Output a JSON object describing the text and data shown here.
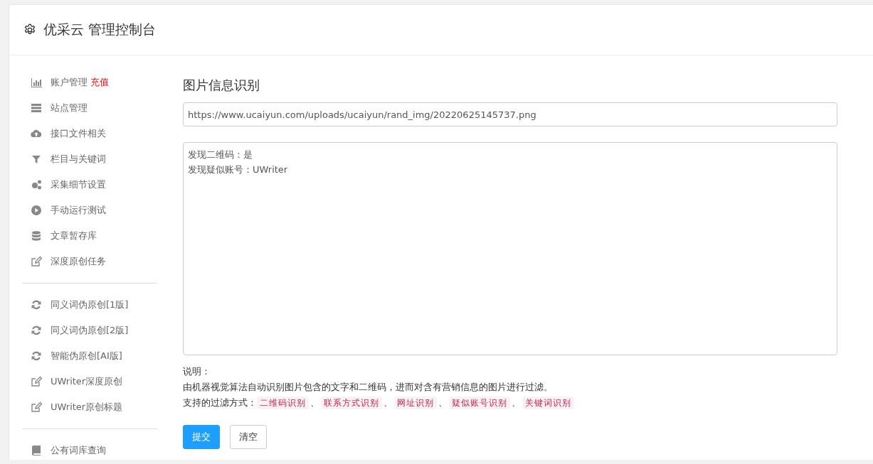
{
  "header": {
    "title": "优采云 管理控制台"
  },
  "sidebar": {
    "groups": [
      {
        "items": [
          {
            "label": "账户管理",
            "badge": "充值"
          },
          {
            "label": "站点管理"
          },
          {
            "label": "接口文件相关"
          },
          {
            "label": "栏目与关键词"
          },
          {
            "label": "采集细节设置"
          },
          {
            "label": "手动运行测试"
          },
          {
            "label": "文章暂存库"
          },
          {
            "label": "深度原创任务"
          }
        ]
      },
      {
        "items": [
          {
            "label": "同义词伪原创[1版]"
          },
          {
            "label": "同义词伪原创[2版]"
          },
          {
            "label": "智能伪原创[AI版]"
          },
          {
            "label": "UWriter深度原创"
          },
          {
            "label": "UWriter原创标题"
          }
        ]
      },
      {
        "items": [
          {
            "label": "公有词库查询"
          }
        ]
      }
    ]
  },
  "main": {
    "title": "图片信息识别",
    "url_field": {
      "value": "https://www.ucaiyun.com/uploads/ucaiyun/rand_img/20220625145737.png"
    },
    "result_box": {
      "lines": [
        "发现二维码：是",
        "发现疑似账号：UWriter"
      ]
    },
    "notes": {
      "label": "说明：",
      "description": "由机器视觉算法自动识别图片包含的文字和二维码，进而对含有营销信息的图片进行过滤。",
      "filters_label": "支持的过滤方式：",
      "filters": [
        "二维码识别",
        "联系方式识别",
        "网址识别",
        "疑似账号识别",
        "关键词识别"
      ],
      "separator": "、"
    },
    "buttons": [
      {
        "kind": "primary",
        "label": "提交"
      },
      {
        "kind": "default",
        "label": "清空"
      }
    ]
  }
}
